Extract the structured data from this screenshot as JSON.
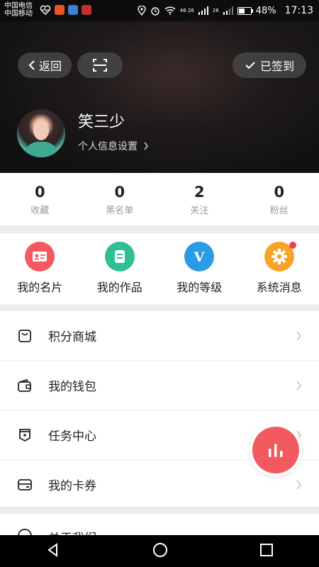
{
  "status_bar": {
    "carrier1": "中国电信",
    "carrier2": "中国移动",
    "signal_text": "46 26",
    "signal2_text": "26",
    "battery": "48%",
    "time": "17:13"
  },
  "header": {
    "back_label": "返回",
    "signed_label": "已签到",
    "username": "笑三少",
    "profile_settings": "个人信息设置"
  },
  "stats": [
    {
      "value": "0",
      "label": "收藏"
    },
    {
      "value": "0",
      "label": "黑名单"
    },
    {
      "value": "2",
      "label": "关注"
    },
    {
      "value": "0",
      "label": "粉丝"
    }
  ],
  "quick": [
    {
      "label": "我的名片",
      "color": "#f25a5f",
      "icon": "id-card-icon"
    },
    {
      "label": "我的作品",
      "color": "#2fbf93",
      "icon": "document-icon"
    },
    {
      "label": "我的等级",
      "color": "#2b9be6",
      "icon": "level-v-icon"
    },
    {
      "label": "系统消息",
      "color": "#f7a326",
      "icon": "gear-icon"
    }
  ],
  "menu": [
    {
      "label": "积分商城",
      "icon": "shopping-bag-icon"
    },
    {
      "label": "我的钱包",
      "icon": "wallet-icon"
    },
    {
      "label": "任务中心",
      "icon": "badge-icon"
    },
    {
      "label": "我的卡券",
      "icon": "card-icon"
    }
  ],
  "partial_row": {
    "label": "关于我们"
  },
  "colors": {
    "accent": "#f25a5f",
    "notification_dot": "#f0424e"
  }
}
